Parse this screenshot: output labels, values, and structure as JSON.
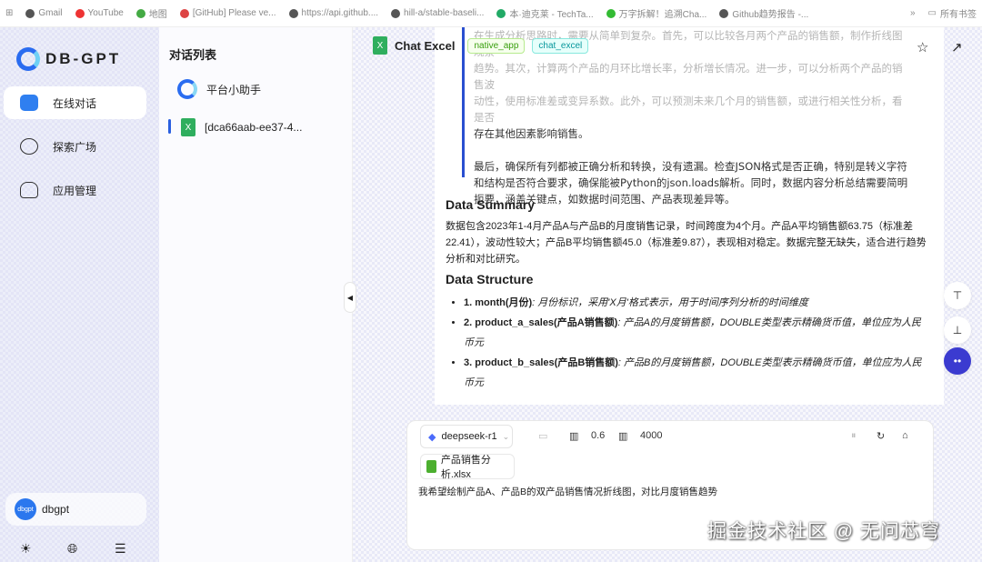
{
  "bookmarks": [
    "Gmail",
    "YouTube",
    "地图",
    "[GitHub] Please ve...",
    "https://api.github....",
    "hill-a/stable-baseli...",
    "本·迪克莱 - TechTa...",
    "万字拆解！追溯Cha...",
    "Github趋势报告 -..."
  ],
  "bookmarks_more": "»",
  "bookmarks_folder": "所有书签",
  "sidebar": {
    "logo": "DB-GPT",
    "items": [
      {
        "label": "在线对话",
        "icon": "chat-icon",
        "active": true
      },
      {
        "label": "探索广场",
        "icon": "explore-icon"
      },
      {
        "label": "应用管理",
        "icon": "robot-icon"
      }
    ],
    "user": {
      "avatar": "dbgpt",
      "name": "dbgpt"
    }
  },
  "conversations": {
    "title": "对话列表",
    "items": [
      {
        "label": "平台小助手"
      },
      {
        "label": "[dca66aab-ee37-4...",
        "active": true
      }
    ]
  },
  "header": {
    "title": "Chat Excel",
    "tags": [
      "native_app",
      "chat_excel"
    ]
  },
  "thinking": {
    "faded": [
      "在生成分析思路时，需要从简单到复杂。首先，可以比较各月两个产品的销售额，制作折线图观察",
      "趋势。其次，计算两个产品的月环比增长率，分析增长情况。进一步，可以分析两个产品的销售波",
      "动性，使用标准差或变异系数。此外，可以预测未来几个月的销售额，或进行相关性分析，看是否"
    ],
    "p1_end": "存在其他因素影响销售。",
    "p2": "最后，确保所有列都被正确分析和转换，没有遗漏。检查JSON格式是否正确，特别是转义字符和结构是否符合要求，确保能被Python的json.loads解析。同时，数据内容分析总结需要简明扼要，涵盖关键点，如数据时间范围、产品表现差异等。"
  },
  "summary": {
    "title": "Data Summary",
    "text": "数据包含2023年1-4月产品A与产品B的月度销售记录，时间跨度为4个月。产品A平均销售额63.75（标准差22.41），波动性较大；产品B平均销售额45.0（标准差9.87），表现相对稳定。数据完整无缺失，适合进行趋势分析和对比研究。"
  },
  "structure": {
    "title": "Data Structure",
    "items": [
      {
        "name": "1. month(月份)",
        "desc": ": 月份标识，采用'X月'格式表示，用于时间序列分析的时间维度"
      },
      {
        "name": "2. product_a_sales(产品A销售额)",
        "desc": ": 产品A的月度销售额，DOUBLE类型表示精确货币值，单位应为人民币元"
      },
      {
        "name": "3. product_b_sales(产品B销售额)",
        "desc": ": 产品B的月度销售额，DOUBLE类型表示精确货币值，单位应为人民币元"
      }
    ]
  },
  "input": {
    "model": "deepseek-r1",
    "temperature": "0.6",
    "max_tokens": "4000",
    "file": "产品销售分析.xlsx",
    "query": "我希望绘制产品A、产品B的双产品销售情况折线图，对比月度销售趋势"
  },
  "watermark": "掘金技术社区 @ 无问芯穹"
}
